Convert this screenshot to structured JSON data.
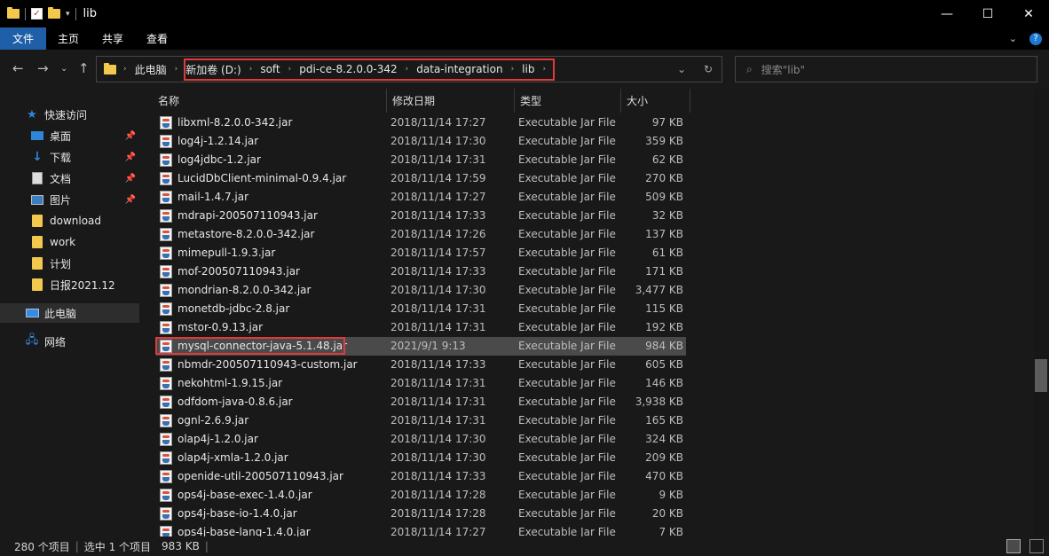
{
  "window": {
    "title": "lib",
    "controls": [
      "—",
      "☐",
      "✕"
    ]
  },
  "ribbon": {
    "tabs": [
      "文件",
      "主页",
      "共享",
      "查看"
    ]
  },
  "address": {
    "breadcrumbs": [
      "此电脑",
      "新加卷 (D:)",
      "soft",
      "pdi-ce-8.2.0.0-342",
      "data-integration",
      "lib"
    ],
    "search_placeholder": "搜索\"lib\""
  },
  "nav": {
    "items": [
      {
        "label": "快速访问",
        "icon": "star-icon"
      },
      {
        "label": "桌面",
        "icon": "desktop-icon",
        "pinned": true
      },
      {
        "label": "下载",
        "icon": "download-icon",
        "pinned": true
      },
      {
        "label": "文档",
        "icon": "document-icon",
        "pinned": true
      },
      {
        "label": "图片",
        "icon": "picture-icon",
        "pinned": true
      },
      {
        "label": "download",
        "icon": "folder-icon"
      },
      {
        "label": "work",
        "icon": "folder-icon"
      },
      {
        "label": "计划",
        "icon": "folder-icon"
      },
      {
        "label": "日报2021.12",
        "icon": "folder-icon"
      },
      {
        "label": "此电脑",
        "icon": "computer-icon",
        "selected": true
      },
      {
        "label": "网络",
        "icon": "network-icon"
      }
    ]
  },
  "columns": {
    "name": "名称",
    "date": "修改日期",
    "type": "类型",
    "size": "大小"
  },
  "files": [
    {
      "name": "libxml-8.2.0.0-342.jar",
      "date": "2018/11/14 17:27",
      "type": "Executable Jar File",
      "size": "97 KB"
    },
    {
      "name": "log4j-1.2.14.jar",
      "date": "2018/11/14 17:30",
      "type": "Executable Jar File",
      "size": "359 KB"
    },
    {
      "name": "log4jdbc-1.2.jar",
      "date": "2018/11/14 17:31",
      "type": "Executable Jar File",
      "size": "62 KB"
    },
    {
      "name": "LucidDbClient-minimal-0.9.4.jar",
      "date": "2018/11/14 17:59",
      "type": "Executable Jar File",
      "size": "270 KB"
    },
    {
      "name": "mail-1.4.7.jar",
      "date": "2018/11/14 17:27",
      "type": "Executable Jar File",
      "size": "509 KB"
    },
    {
      "name": "mdrapi-200507110943.jar",
      "date": "2018/11/14 17:33",
      "type": "Executable Jar File",
      "size": "32 KB"
    },
    {
      "name": "metastore-8.2.0.0-342.jar",
      "date": "2018/11/14 17:26",
      "type": "Executable Jar File",
      "size": "137 KB"
    },
    {
      "name": "mimepull-1.9.3.jar",
      "date": "2018/11/14 17:57",
      "type": "Executable Jar File",
      "size": "61 KB"
    },
    {
      "name": "mof-200507110943.jar",
      "date": "2018/11/14 17:33",
      "type": "Executable Jar File",
      "size": "171 KB"
    },
    {
      "name": "mondrian-8.2.0.0-342.jar",
      "date": "2018/11/14 17:30",
      "type": "Executable Jar File",
      "size": "3,477 KB"
    },
    {
      "name": "monetdb-jdbc-2.8.jar",
      "date": "2018/11/14 17:31",
      "type": "Executable Jar File",
      "size": "115 KB"
    },
    {
      "name": "mstor-0.9.13.jar",
      "date": "2018/11/14 17:31",
      "type": "Executable Jar File",
      "size": "192 KB"
    },
    {
      "name": "mysql-connector-java-5.1.48.jar",
      "date": "2021/9/1 9:13",
      "type": "Executable Jar File",
      "size": "984 KB",
      "selected": true
    },
    {
      "name": "nbmdr-200507110943-custom.jar",
      "date": "2018/11/14 17:33",
      "type": "Executable Jar File",
      "size": "605 KB"
    },
    {
      "name": "nekohtml-1.9.15.jar",
      "date": "2018/11/14 17:31",
      "type": "Executable Jar File",
      "size": "146 KB"
    },
    {
      "name": "odfdom-java-0.8.6.jar",
      "date": "2018/11/14 17:31",
      "type": "Executable Jar File",
      "size": "3,938 KB"
    },
    {
      "name": "ognl-2.6.9.jar",
      "date": "2018/11/14 17:31",
      "type": "Executable Jar File",
      "size": "165 KB"
    },
    {
      "name": "olap4j-1.2.0.jar",
      "date": "2018/11/14 17:30",
      "type": "Executable Jar File",
      "size": "324 KB"
    },
    {
      "name": "olap4j-xmla-1.2.0.jar",
      "date": "2018/11/14 17:30",
      "type": "Executable Jar File",
      "size": "209 KB"
    },
    {
      "name": "openide-util-200507110943.jar",
      "date": "2018/11/14 17:33",
      "type": "Executable Jar File",
      "size": "470 KB"
    },
    {
      "name": "ops4j-base-exec-1.4.0.jar",
      "date": "2018/11/14 17:28",
      "type": "Executable Jar File",
      "size": "9 KB"
    },
    {
      "name": "ops4j-base-io-1.4.0.jar",
      "date": "2018/11/14 17:28",
      "type": "Executable Jar File",
      "size": "20 KB"
    },
    {
      "name": "ops4j-base-lang-1.4.0.jar",
      "date": "2018/11/14 17:27",
      "type": "Executable Jar File",
      "size": "7 KB"
    }
  ],
  "status": {
    "count": "280 个项目",
    "selection": "选中 1 个项目",
    "selection_size": "983 KB"
  },
  "colors": {
    "file_tab": "#1f5fa8",
    "highlight_box": "#e03a3a",
    "selected_row": "#4a4a4a"
  }
}
